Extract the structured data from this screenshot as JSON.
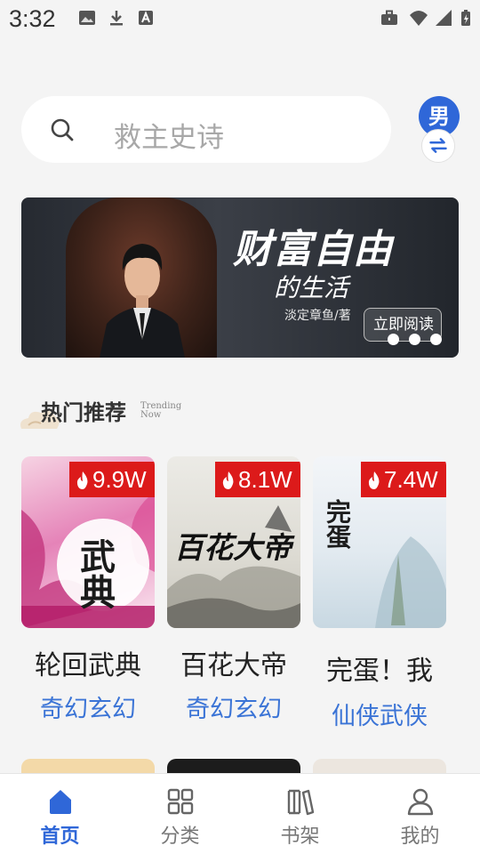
{
  "status_bar": {
    "time": "3:32",
    "left_icons": [
      "image-icon",
      "download-icon",
      "text-a-icon"
    ],
    "right_icons": [
      "briefcase-icon",
      "wifi-icon",
      "signal-icon",
      "battery-icon"
    ]
  },
  "search": {
    "placeholder": "救主史诗"
  },
  "gender": {
    "label": "男",
    "swap_icon": "swap-icon",
    "color": "#2f67d8"
  },
  "banner": {
    "title": "财富自由",
    "subtitle": "的生活",
    "author": "淡定章鱼/著",
    "cta": "立即阅读",
    "slide_count": 3
  },
  "section": {
    "title": "热门推荐",
    "subtitle_line1": "Trending",
    "subtitle_line2": "Now"
  },
  "books": [
    {
      "title": "轮回武典",
      "genre": "奇幻玄幻",
      "heat": "9.9W",
      "cover_text": "武典"
    },
    {
      "title": "百花大帝",
      "genre": "奇幻玄幻",
      "heat": "8.1W",
      "cover_text": "百花大帝"
    },
    {
      "title": "完蛋！我",
      "genre": "仙侠武侠",
      "heat": "7.4W",
      "cover_text": "完蛋"
    }
  ],
  "nav": {
    "items": [
      {
        "label": "首页",
        "icon": "home-icon",
        "active": true
      },
      {
        "label": "分类",
        "icon": "grid-icon",
        "active": false
      },
      {
        "label": "书架",
        "icon": "bookshelf-icon",
        "active": false
      },
      {
        "label": "我的",
        "icon": "user-icon",
        "active": false
      }
    ]
  },
  "colors": {
    "accent": "#2f67d8",
    "genre": "#3b74d6",
    "badge": "#dc1a1a"
  }
}
